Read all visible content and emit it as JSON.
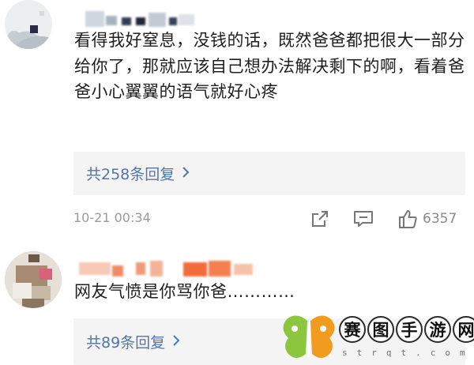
{
  "comments": [
    {
      "text": "看得我好窒息，没钱的话，既然爸爸都把很大一部分给你了，那就应该自己想办法解决剩下的啊，看着爸爸小心翼翼的语气就好心疼",
      "replies": "共258条回复",
      "timestamp": "10-21 00:34",
      "likes": "6357"
    },
    {
      "text": "网友气愤是你骂你爸…………",
      "replies": "共89条回复"
    }
  ],
  "icons": {
    "share": "share-icon",
    "comment": "comment-icon",
    "like": "like-icon",
    "reply_more": "chevron-right-icon"
  },
  "watermark": {
    "chars": [
      "赛",
      "图",
      "手",
      "游",
      "网"
    ],
    "sub": "strqt.com"
  },
  "colors": {
    "link": "#5276a7",
    "reply_bg": "#f4f4f5",
    "muted": "#9a9a9a",
    "logo_green": "#8cc63f"
  }
}
